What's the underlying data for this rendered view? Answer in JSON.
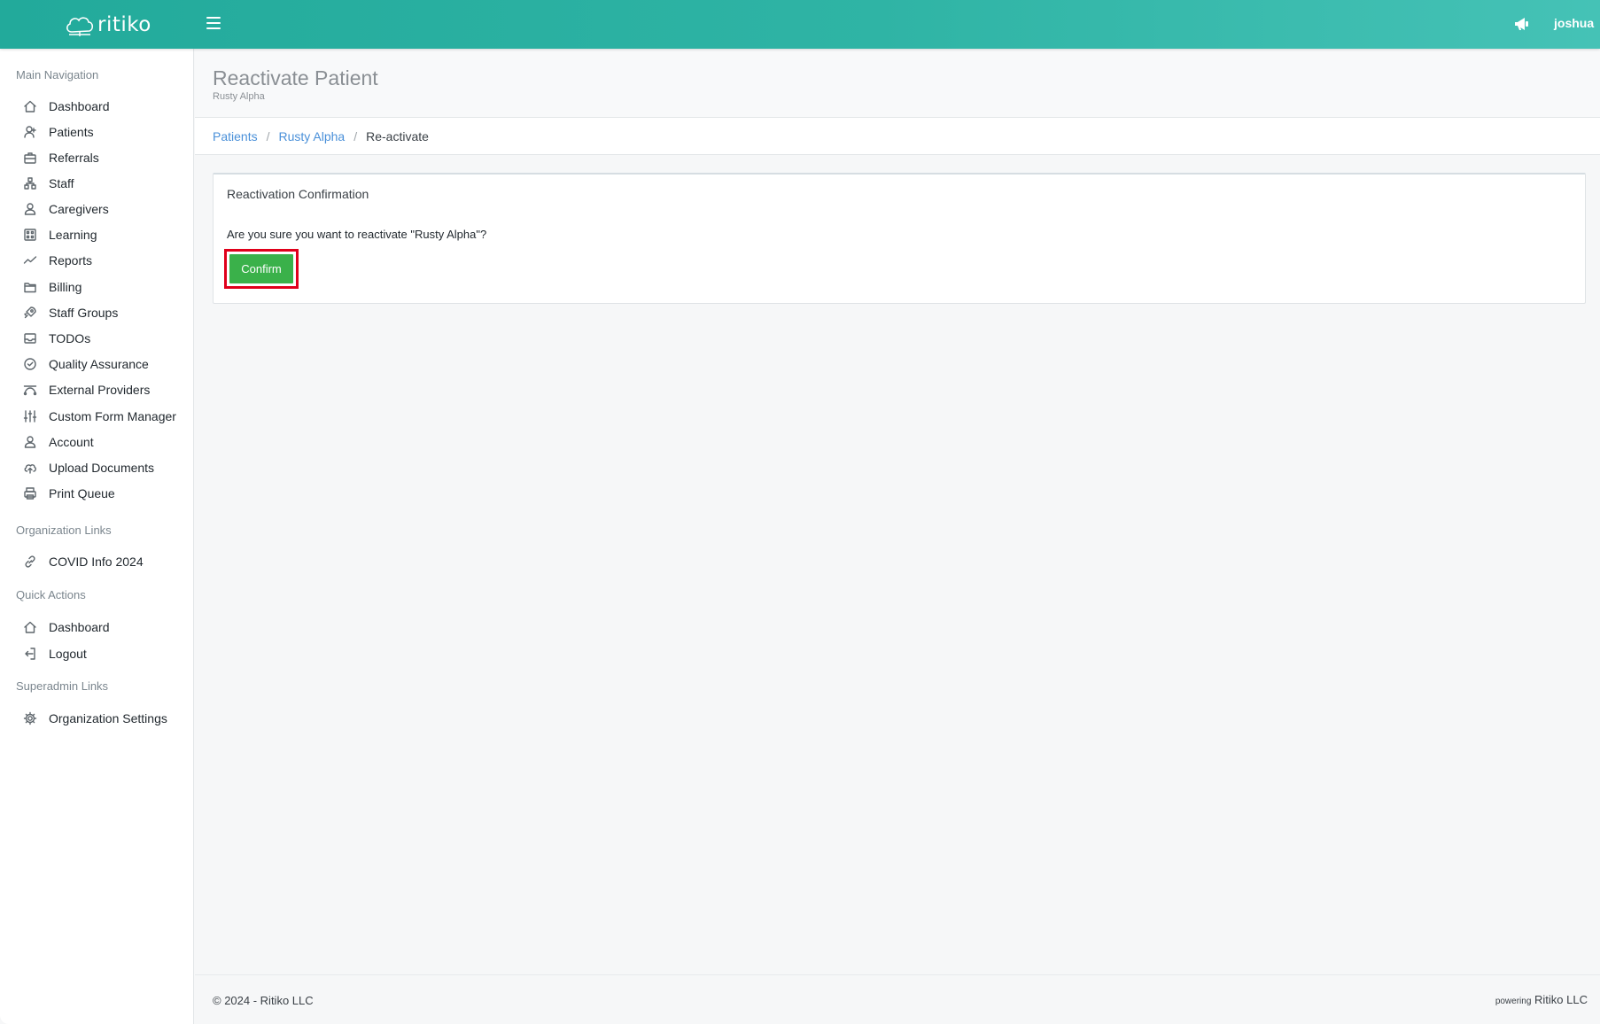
{
  "topbar": {
    "brand": "ritiko",
    "user": "joshua",
    "colors": {
      "start": "#22aa9b",
      "end": "#45c2b6"
    }
  },
  "sidebar": {
    "sections": {
      "main": "Main Navigation",
      "org": "Organization Links",
      "quick": "Quick Actions",
      "superadmin": "Superadmin Links"
    },
    "items": [
      {
        "label": "Dashboard",
        "icon": "home-icon"
      },
      {
        "label": "Patients",
        "icon": "patient-icon"
      },
      {
        "label": "Referrals",
        "icon": "briefcase-icon"
      },
      {
        "label": "Staff",
        "icon": "org-chart-icon"
      },
      {
        "label": "Caregivers",
        "icon": "user-icon"
      },
      {
        "label": "Learning",
        "icon": "grid-icon"
      },
      {
        "label": "Reports",
        "icon": "chart-line-icon"
      },
      {
        "label": "Billing",
        "icon": "folder-icon"
      },
      {
        "label": "Staff Groups",
        "icon": "rocket-icon"
      },
      {
        "label": "TODOs",
        "icon": "inbox-icon"
      },
      {
        "label": "Quality Assurance",
        "icon": "check-circle-icon"
      },
      {
        "label": "External Providers",
        "icon": "bezier-icon"
      },
      {
        "label": "Custom Form Manager",
        "icon": "sliders-icon"
      },
      {
        "label": "Account",
        "icon": "user-icon"
      },
      {
        "label": "Upload Documents",
        "icon": "cloud-upload-icon"
      },
      {
        "label": "Print Queue",
        "icon": "printer-icon"
      }
    ],
    "org_items": [
      {
        "label": "COVID Info 2024",
        "icon": "link-icon"
      }
    ],
    "quick_items": [
      {
        "label": "Dashboard",
        "icon": "home-icon"
      },
      {
        "label": "Logout",
        "icon": "logout-icon"
      }
    ],
    "superadmin_items": [
      {
        "label": "Organization Settings",
        "icon": "gear-icon"
      }
    ]
  },
  "page": {
    "title": "Reactivate Patient",
    "subtitle": "Rusty Alpha"
  },
  "breadcrumb": {
    "items": [
      "Patients",
      "Rusty Alpha"
    ],
    "current": "Re-activate",
    "separator": "/"
  },
  "card": {
    "title": "Reactivation Confirmation",
    "text": "Are you sure you want to reactivate \"Rusty Alpha\"?",
    "confirm_label": "Confirm",
    "confirm_color": "#3ab14a",
    "highlight_color": "#e0001b"
  },
  "footer": {
    "left": "© 2024 - Ritiko LLC",
    "right_small": "powering",
    "right": "Ritiko LLC"
  }
}
